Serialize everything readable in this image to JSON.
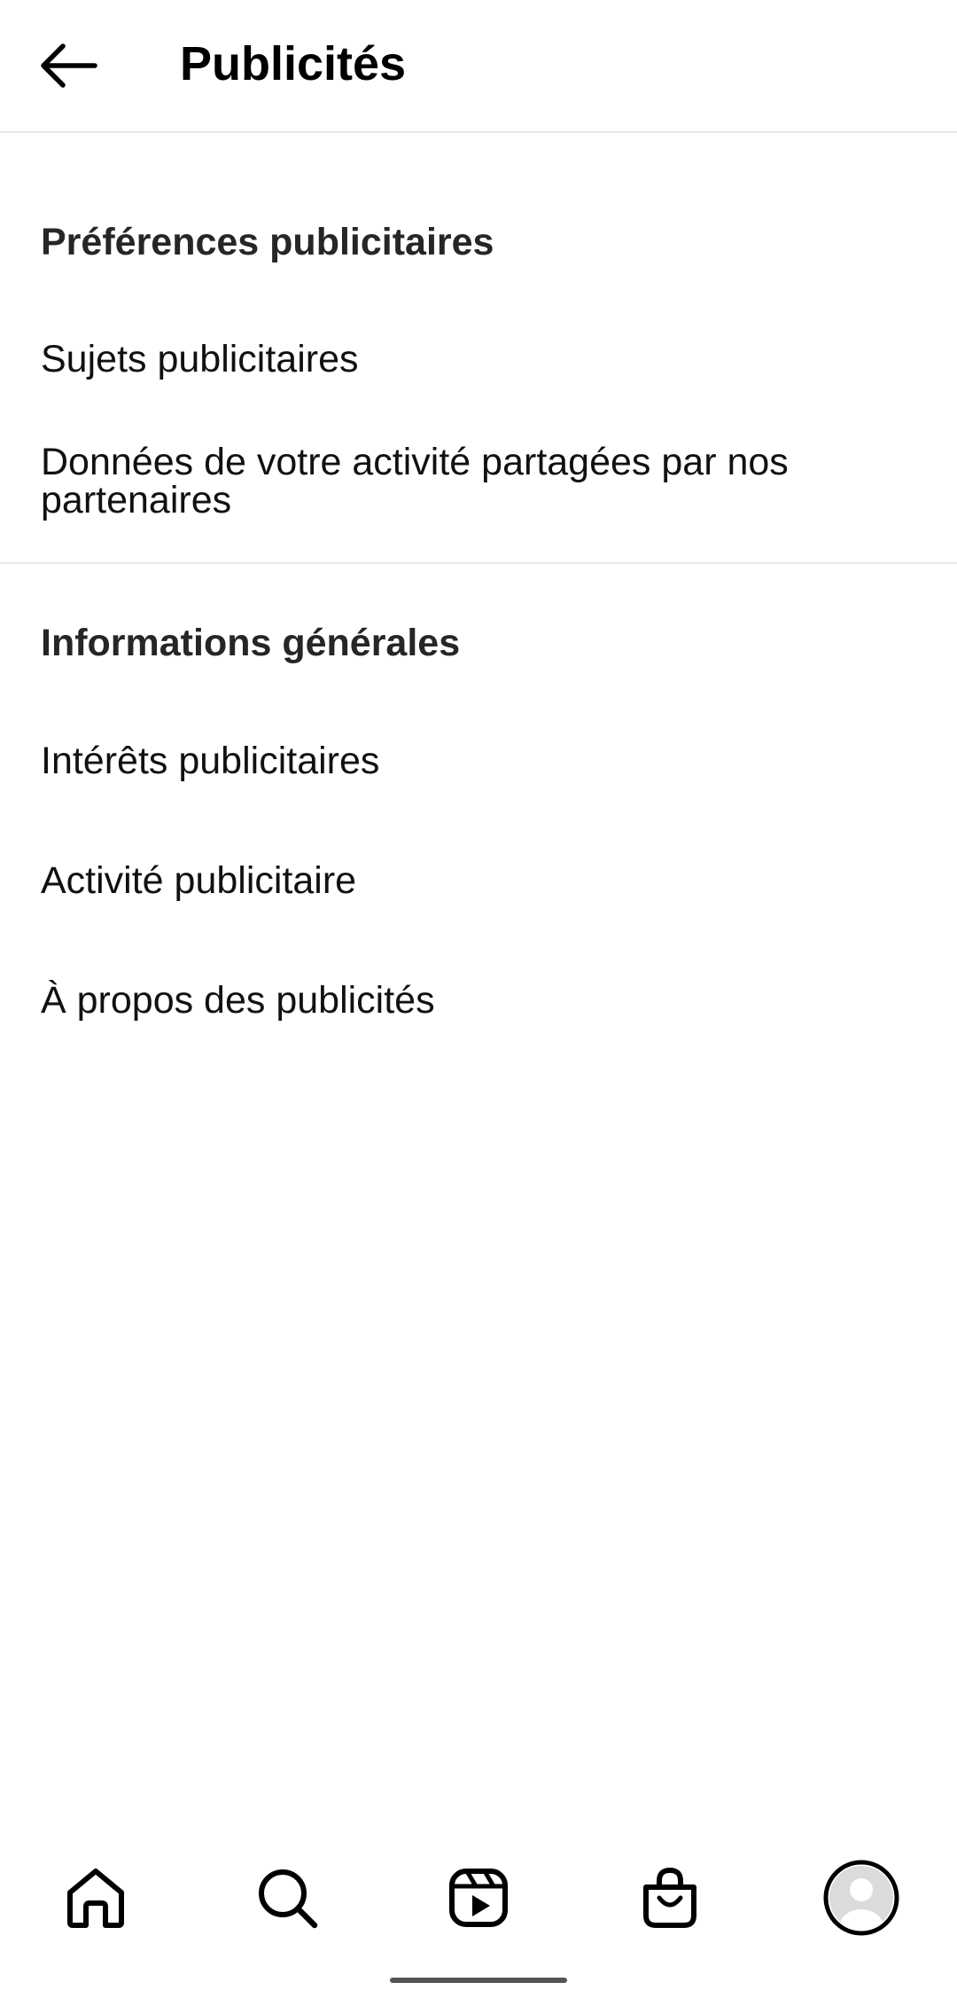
{
  "header": {
    "title": "Publicités",
    "back_icon": "arrow-left-icon"
  },
  "sections": [
    {
      "title": "Préférences publicitaires",
      "items": [
        {
          "label": "Sujets publicitaires"
        },
        {
          "label": "Données de votre activité partagées par nos partenaires"
        }
      ]
    },
    {
      "title": "Informations générales",
      "items": [
        {
          "label": "Intérêts publicitaires"
        },
        {
          "label": "Activité publicitaire"
        },
        {
          "label": "À propos des publicités"
        }
      ]
    }
  ],
  "bottom_nav": {
    "items": [
      {
        "icon": "home-icon"
      },
      {
        "icon": "search-icon"
      },
      {
        "icon": "reels-icon"
      },
      {
        "icon": "shop-icon"
      },
      {
        "icon": "profile-avatar-icon"
      }
    ]
  },
  "colors": {
    "text": "#111111",
    "section_header": "#262626",
    "divider": "#e6e6e6"
  }
}
